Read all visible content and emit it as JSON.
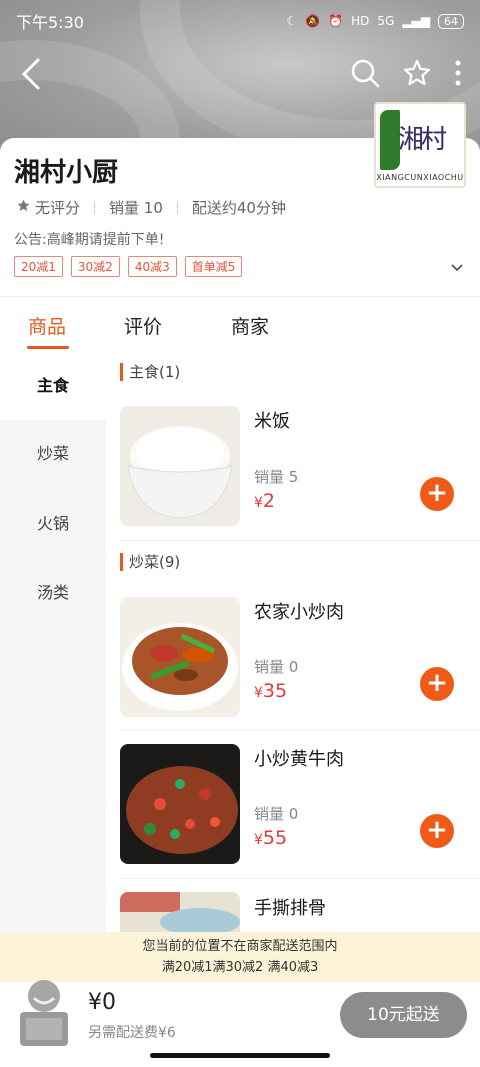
{
  "status_bar": {
    "time": "下午5:30",
    "signal": "5G",
    "battery": "64"
  },
  "store": {
    "name": "湘村小厨",
    "rating": "无评分",
    "sales": "销量 10",
    "delivery": "配送约40分钟",
    "notice": "公告:高峰期请提前下单!",
    "promos": [
      "20减1",
      "30减2",
      "40减3",
      "首单减5"
    ],
    "logo_text": "湘村小厨",
    "logo_sub": "XIANGCUNXIAOCHU"
  },
  "tabs": [
    {
      "label": "商品",
      "active": true
    },
    {
      "label": "评价",
      "active": false
    },
    {
      "label": "商家",
      "active": false
    }
  ],
  "categories": [
    {
      "label": "主食",
      "active": true
    },
    {
      "label": "炒菜",
      "active": false
    },
    {
      "label": "火锅",
      "active": false
    },
    {
      "label": "汤类",
      "active": false
    }
  ],
  "sections": [
    {
      "title": "主食(1)"
    },
    {
      "title": "炒菜(9)"
    }
  ],
  "items": [
    {
      "name": "米饭",
      "sales": "销量 5",
      "price": "2"
    },
    {
      "name": "农家小炒肉",
      "sales": "销量 0",
      "price": "35"
    },
    {
      "name": "小炒黄牛肉",
      "sales": "销量 0",
      "price": "55"
    },
    {
      "name": "手撕排骨"
    }
  ],
  "currency": "¥",
  "warning": {
    "line1": "您当前的位置不在商家配送范围内",
    "line2": "满20减1满30减2 满40减3"
  },
  "cart": {
    "total": "¥0",
    "fee": "另需配送费¥6",
    "button": "10元起送"
  },
  "colors": {
    "accent": "#e65a1c",
    "price": "#e6393b",
    "add_button": "#ef5a17",
    "warning_bg": "#fcf3d8"
  }
}
